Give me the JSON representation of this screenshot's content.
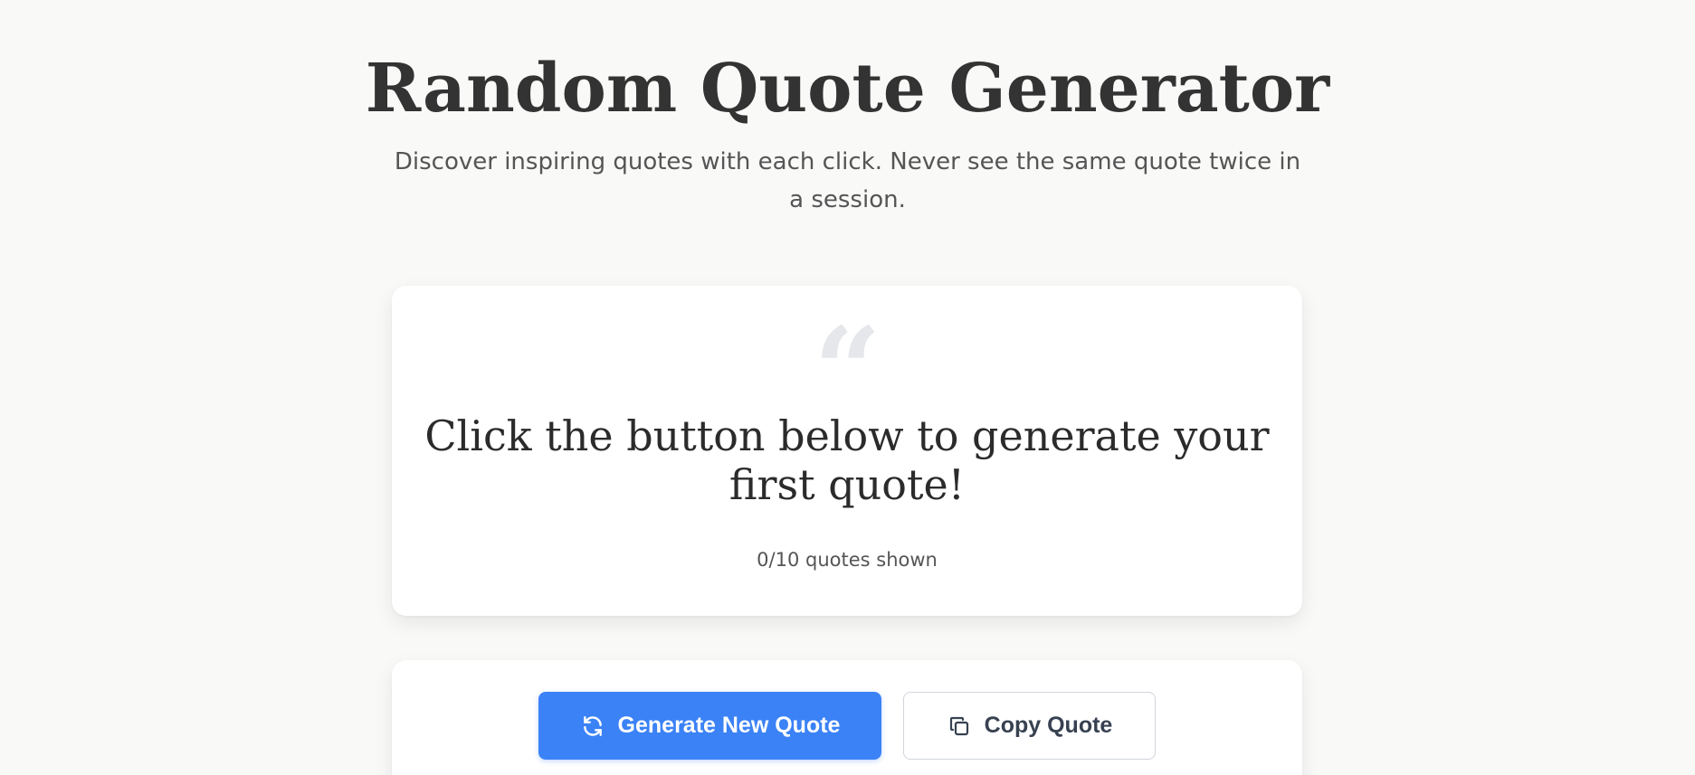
{
  "header": {
    "title": "Random Quote Generator",
    "subtitle": "Discover inspiring quotes with each click. Never see the same quote twice in a session."
  },
  "quote_card": {
    "quote_mark": "“",
    "quote_text": "Click the button below to generate your first quote!",
    "counter": "0/10 quotes shown"
  },
  "controls": {
    "generate_label": "Generate New Quote",
    "generate_icon": "refresh-icon",
    "copy_label": "Copy Quote",
    "copy_icon": "copy-icon"
  },
  "colors": {
    "accent": "#3b82f6",
    "background": "#f9f9f8",
    "card": "#ffffff",
    "quote_mark": "#e5e7eb"
  }
}
